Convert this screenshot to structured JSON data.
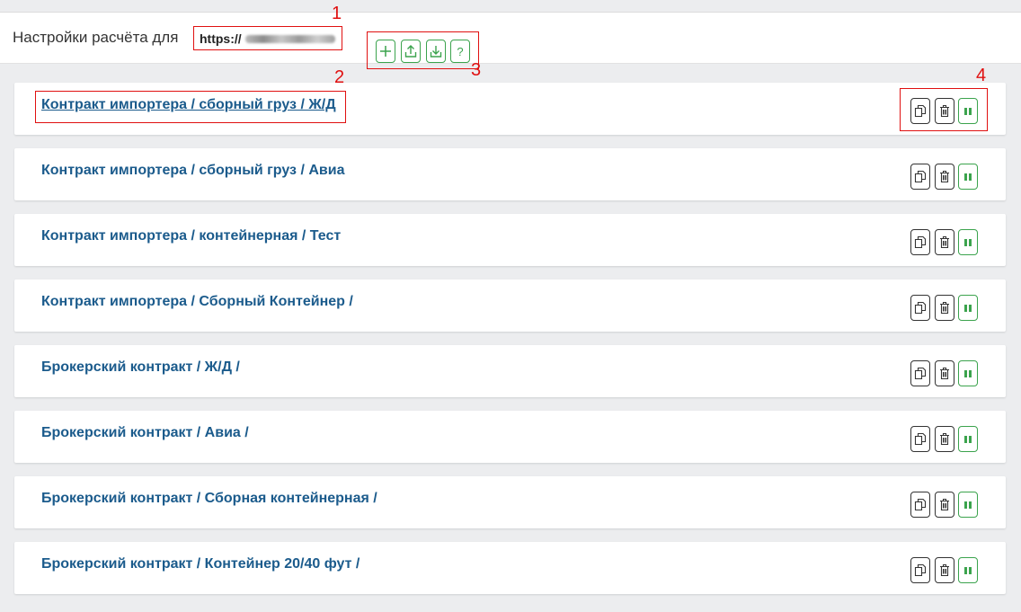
{
  "header": {
    "settings_label": "Настройки расчёта для",
    "site_url": "https://",
    "tools": [
      {
        "icon": "plus-icon"
      },
      {
        "icon": "upload-icon"
      },
      {
        "icon": "download-icon"
      },
      {
        "icon": "help-icon",
        "label": "?"
      }
    ]
  },
  "annotations": [
    "1",
    "2",
    "3",
    "4"
  ],
  "colors": {
    "link": "#1b5b8c",
    "green": "#3ba34d",
    "annotation_red": "#e01010",
    "background": "#ecedef"
  },
  "contracts": [
    {
      "title": "Контракт импортера / сборный груз / Ж/Д"
    },
    {
      "title": "Контракт импортера / сборный груз / Авиа"
    },
    {
      "title": "Контракт импортера / контейнерная / Тест"
    },
    {
      "title": "Контракт импортера / Сборный Контейнер /"
    },
    {
      "title": "Брокерский контракт / Ж/Д /"
    },
    {
      "title": "Брокерский контракт / Авиа /"
    },
    {
      "title": "Брокерский контракт / Сборная контейнерная /"
    },
    {
      "title": "Брокерский контракт / Контейнер 20/40 фут /"
    }
  ],
  "row_actions": [
    "copy-icon",
    "delete-icon",
    "pause-icon"
  ]
}
